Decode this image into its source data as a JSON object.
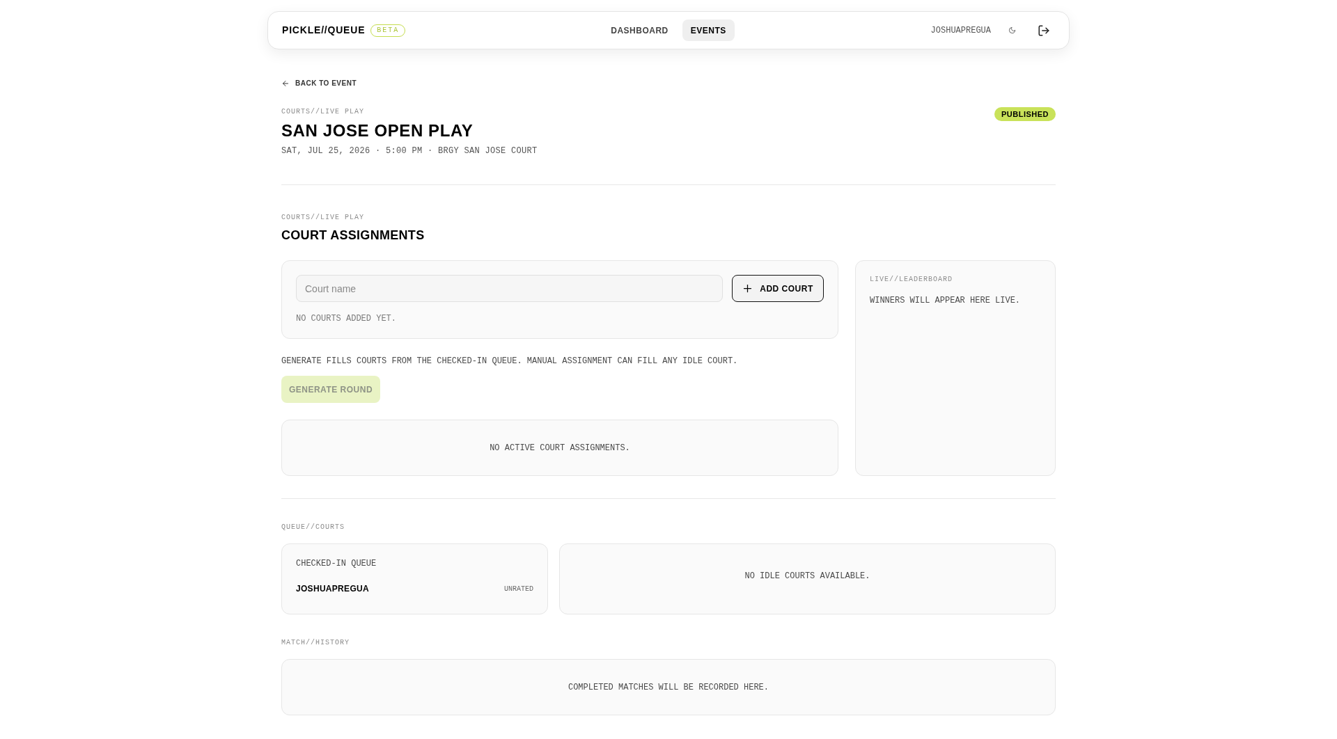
{
  "header": {
    "logo": "PICKLE//QUEUE",
    "badge": "BETA",
    "nav": [
      {
        "label": "DASHBOARD",
        "selected": false
      },
      {
        "label": "EVENTS",
        "selected": true
      }
    ],
    "user": "JOSHUAPREGUA"
  },
  "back_link": "BACK TO EVENT",
  "event": {
    "eyebrow": "COURTS//LIVE PLAY",
    "title": "SAN JOSE OPEN PLAY",
    "meta": "SAT, JUL 25, 2026 · 5:00 PM · BRGY SAN JOSE COURT",
    "status": "PUBLISHED"
  },
  "court_assignments": {
    "eyebrow": "COURTS//LIVE PLAY",
    "title": "COURT ASSIGNMENTS",
    "court_input": {
      "placeholder": "Court name"
    },
    "add_button": "ADD COURT",
    "courts_empty": "NO COURTS ADDED YET.",
    "help": "GENERATE FILLS COURTS FROM THE CHECKED-IN QUEUE. MANUAL ASSIGNMENT CAN FILL ANY IDLE COURT.",
    "generate_button": {
      "label": "GENERATE ROUND",
      "disabled": true
    },
    "assignments_empty": "NO ACTIVE COURT ASSIGNMENTS."
  },
  "leaderboard": {
    "eyebrow": "LIVE//LEADERBOARD",
    "empty": "WINNERS WILL APPEAR HERE LIVE."
  },
  "queue_courts": {
    "eyebrow": "QUEUE//COURTS",
    "queue": {
      "title": "CHECKED-IN QUEUE",
      "players": [
        {
          "name": "JOSHUAPREGUA",
          "rating": "UNRATED"
        }
      ]
    },
    "idle_empty": "NO IDLE COURTS AVAILABLE."
  },
  "match_history": {
    "eyebrow": "MATCH//HISTORY",
    "empty": "COMPLETED MATCHES WILL BE RECORDED HERE."
  }
}
